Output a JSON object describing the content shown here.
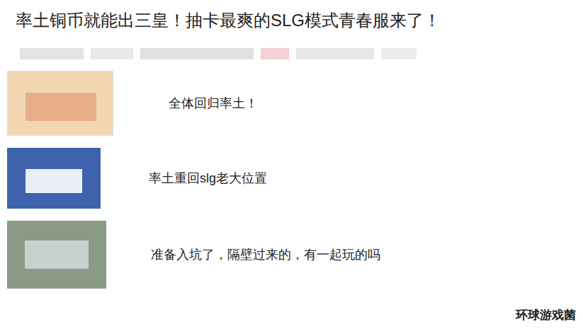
{
  "article": {
    "title": "率土铜币就能出三皇！抽卡最爽的SLG模式青春服来了！"
  },
  "comments": [
    {
      "text": "全体回归率土！"
    },
    {
      "text": "率土重回slg老大位置"
    },
    {
      "text": "准备入坑了，隔壁过来的，有一起玩的吗"
    }
  ],
  "watermark": {
    "text": "环球游戏菌"
  }
}
